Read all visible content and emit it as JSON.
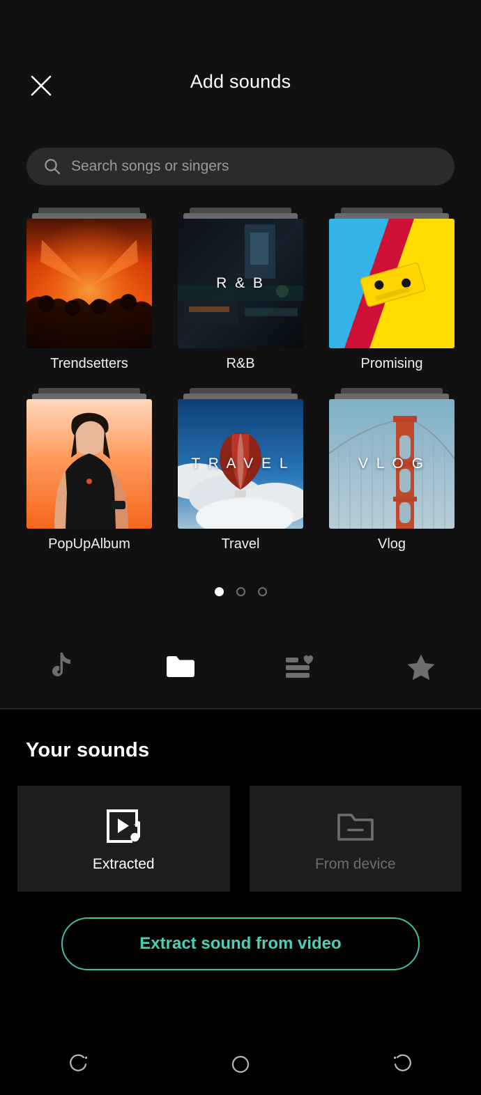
{
  "header": {
    "title": "Add sounds",
    "close_icon": "close-icon"
  },
  "search": {
    "placeholder": "Search songs or singers",
    "value": "",
    "icon": "search-icon"
  },
  "categories": [
    {
      "label": "Trendsetters",
      "overlay_text": "",
      "art": "concert-crowd-red"
    },
    {
      "label": "R&B",
      "overlay_text": "R & B",
      "art": "studio-dark"
    },
    {
      "label": "Promising",
      "overlay_text": "",
      "art": "cassette-yellow-cyan"
    },
    {
      "label": "PopUpAlbum",
      "overlay_text": "",
      "art": "portrait-orange"
    },
    {
      "label": "Travel",
      "overlay_text": "T R A V E L",
      "art": "hot-air-balloon"
    },
    {
      "label": "Vlog",
      "overlay_text": "V L O G",
      "art": "golden-gate-bridge"
    }
  ],
  "pagination": {
    "total": 3,
    "active_index": 1
  },
  "tabs": [
    {
      "name": "tiktok-note-icon",
      "active": false
    },
    {
      "name": "folder-icon",
      "active": true
    },
    {
      "name": "playlist-heart-icon",
      "active": false
    },
    {
      "name": "star-icon",
      "active": false
    }
  ],
  "your_sounds": {
    "title": "Your sounds",
    "tiles": [
      {
        "label": "Extracted",
        "icon": "video-music-icon",
        "enabled": true
      },
      {
        "label": "From device",
        "icon": "folder-minus-icon",
        "enabled": false
      }
    ],
    "extract_button": "Extract sound from video"
  },
  "nav": [
    {
      "name": "recents-button"
    },
    {
      "name": "home-button"
    },
    {
      "name": "back-button"
    }
  ],
  "colors": {
    "accent": "#4ad0b6",
    "accent_border": "#3fbfa8",
    "panel": "#111111",
    "tile": "#1e1e1e",
    "search_field": "#2b2b2b",
    "text_muted": "#9a9a9a"
  }
}
